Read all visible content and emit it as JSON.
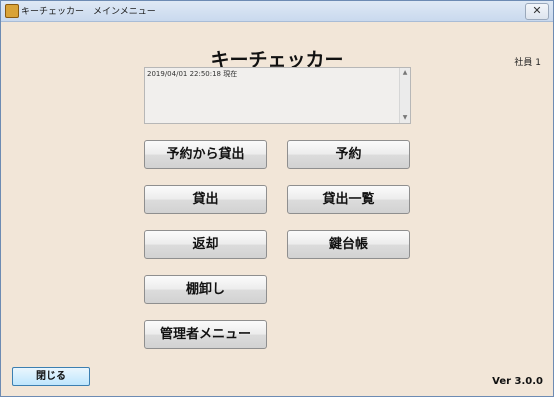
{
  "window": {
    "title": "キーチェッカー　メインメニュー",
    "close_glyph": "✕"
  },
  "header": {
    "app_title": "キーチェッカー",
    "user": "社員 1"
  },
  "log": {
    "text": "2019/04/01 22:50:18 現在"
  },
  "buttons": {
    "reserve_lend": "予約から貸出",
    "reserve": "予約",
    "lend": "貸出",
    "lend_list": "貸出一覧",
    "return": "返却",
    "key_ledger": "鍵台帳",
    "inventory": "棚卸し",
    "admin_menu": "管理者メニュー"
  },
  "footer": {
    "close_label": "閉じる",
    "version": "Ver 3.0.0"
  },
  "icons": {
    "app": "app-icon",
    "close": "close-icon",
    "scroll_up": "scroll-up-icon",
    "scroll_down": "scroll-down-icon"
  },
  "colors": {
    "background": "#f2e6d8",
    "close_button": "#bee6fd"
  }
}
